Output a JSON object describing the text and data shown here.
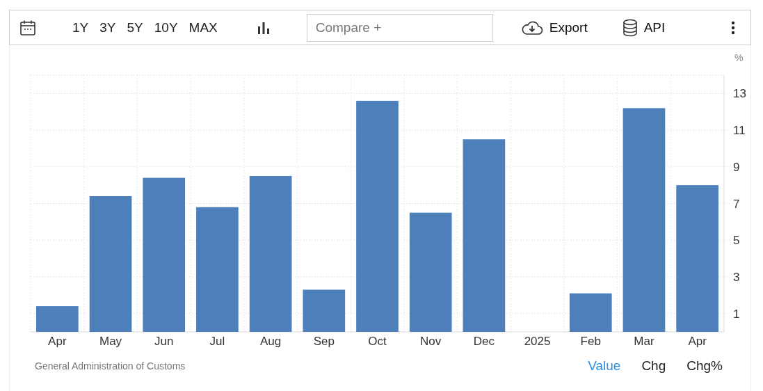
{
  "toolbar": {
    "ranges": [
      "1Y",
      "3Y",
      "5Y",
      "10Y",
      "MAX"
    ],
    "compare": {
      "placeholder": "Compare +"
    },
    "export": "Export",
    "api": "API"
  },
  "chart": {
    "unit": "%",
    "chart_data": {
      "type": "bar",
      "categories": [
        "Apr",
        "May",
        "Jun",
        "Jul",
        "Aug",
        "Sep",
        "Oct",
        "Nov",
        "Dec",
        "2025",
        "Feb",
        "Mar",
        "Apr"
      ],
      "series": [
        {
          "color": "#4d80bb",
          "values": [
            1.4,
            7.4,
            8.4,
            6.8,
            8.5,
            2.3,
            12.6,
            6.5,
            10.5,
            null,
            2.1,
            12.2,
            8.0
          ]
        }
      ],
      "ylim": [
        0,
        14
      ],
      "grid": true,
      "yticks": [
        1,
        3,
        5,
        7,
        9,
        11,
        13
      ]
    }
  },
  "footer": {
    "source": "General Administration of Customs",
    "views": [
      {
        "label": "Value",
        "selected": true
      },
      {
        "label": "Chg",
        "selected": false
      },
      {
        "label": "Chg%",
        "selected": false
      }
    ]
  }
}
